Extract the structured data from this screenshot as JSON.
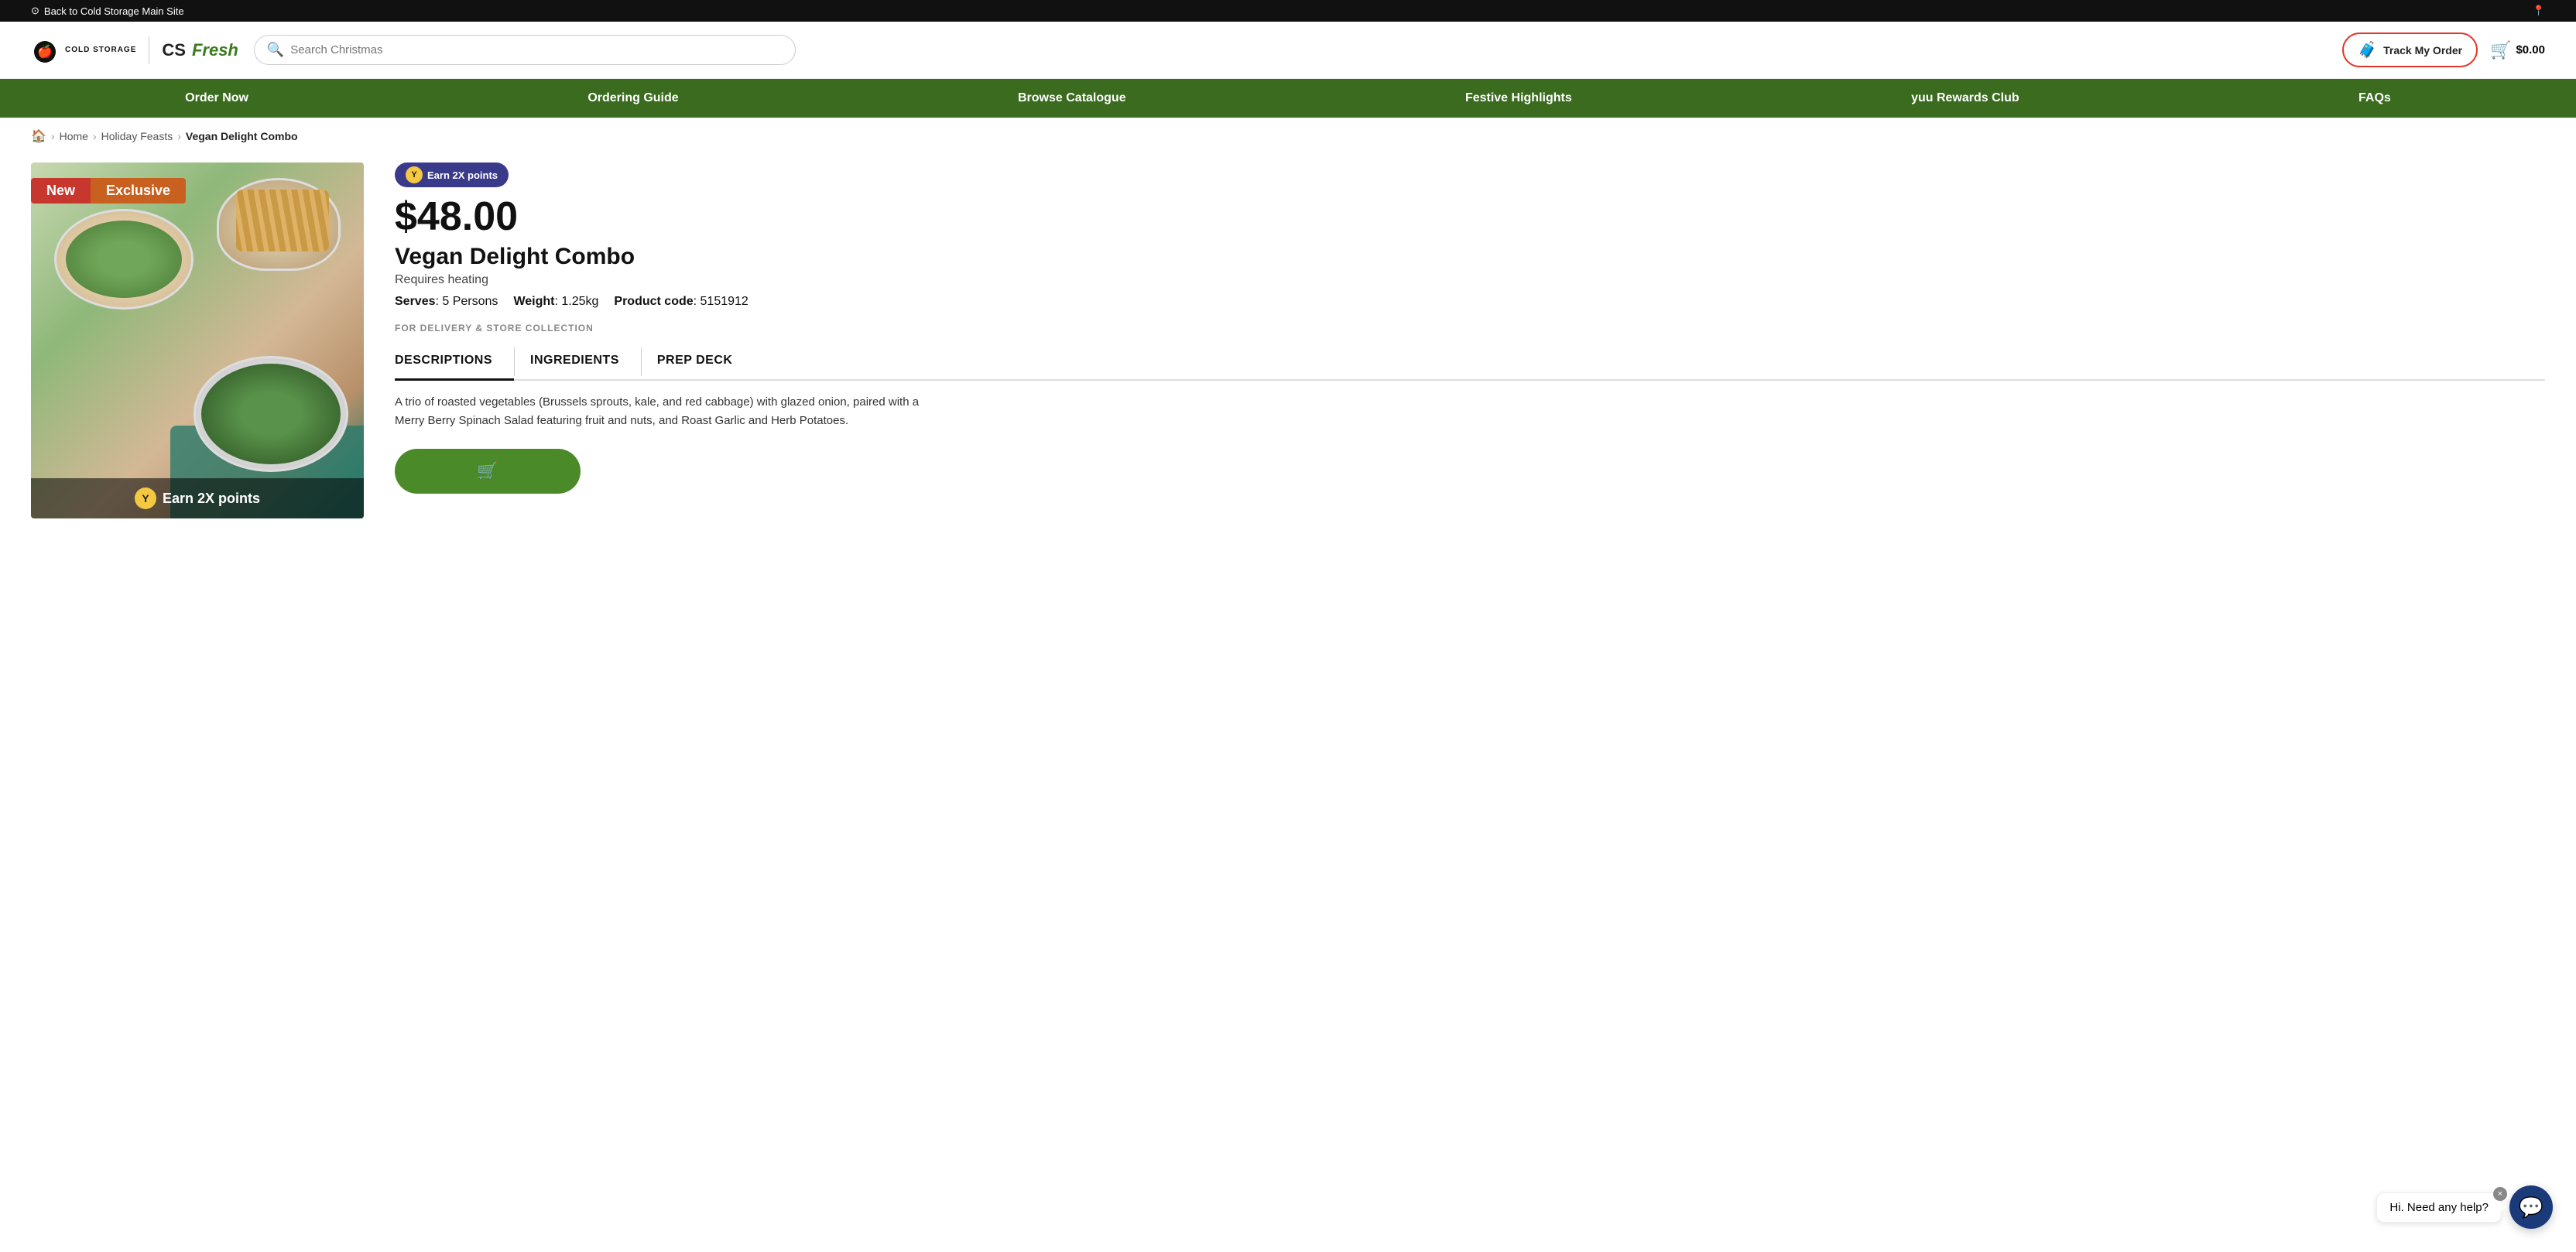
{
  "topbar": {
    "back_link": "Back to Cold Storage Main Site",
    "location_icon": "📍"
  },
  "header": {
    "logo_cold": "COLD STORAGE",
    "logo_cs": "CS",
    "logo_fresh": "Fresh",
    "search_placeholder": "Search Christmas",
    "track_order_label": "Track My Order",
    "cart_amount": "$0.00"
  },
  "nav": {
    "items": [
      {
        "label": "Order Now"
      },
      {
        "label": "Ordering Guide"
      },
      {
        "label": "Browse Catalogue"
      },
      {
        "label": "Festive Highlights"
      },
      {
        "label": "yuu Rewards Club"
      },
      {
        "label": "FAQs"
      }
    ]
  },
  "breadcrumb": {
    "home": "Home",
    "holiday_feasts": "Holiday Feasts",
    "current": "Vegan Delight Combo"
  },
  "product": {
    "badge_new": "New",
    "badge_exclusive": "Exclusive",
    "earn_points_label": "Earn 2X points",
    "price": "$48.00",
    "name": "Vegan Delight Combo",
    "heating_note": "Requires heating",
    "serves_label": "Serves",
    "serves_value": "5 Persons",
    "weight_label": "Weight",
    "weight_value": "1.25kg",
    "product_code_label": "Product code",
    "product_code_value": "5151912",
    "delivery_label": "FOR DELIVERY & STORE COLLECTION",
    "tab_descriptions": "DESCRIPTIONS",
    "tab_ingredients": "INGREDIENTS",
    "tab_prep_deck": "PREP DECK",
    "description": "A trio of roasted vegetables (Brussels sprouts, kale, and red cabbage) with glazed onion, paired with a Merry Berry Spinach Salad featuring fruit and nuts, and Roast Garlic and Herb Potatoes.",
    "add_to_cart_label": "🛒",
    "earn_overlay": "Earn 2X points"
  },
  "chat": {
    "tooltip": "Hi. Need any help?",
    "close_icon": "×"
  }
}
